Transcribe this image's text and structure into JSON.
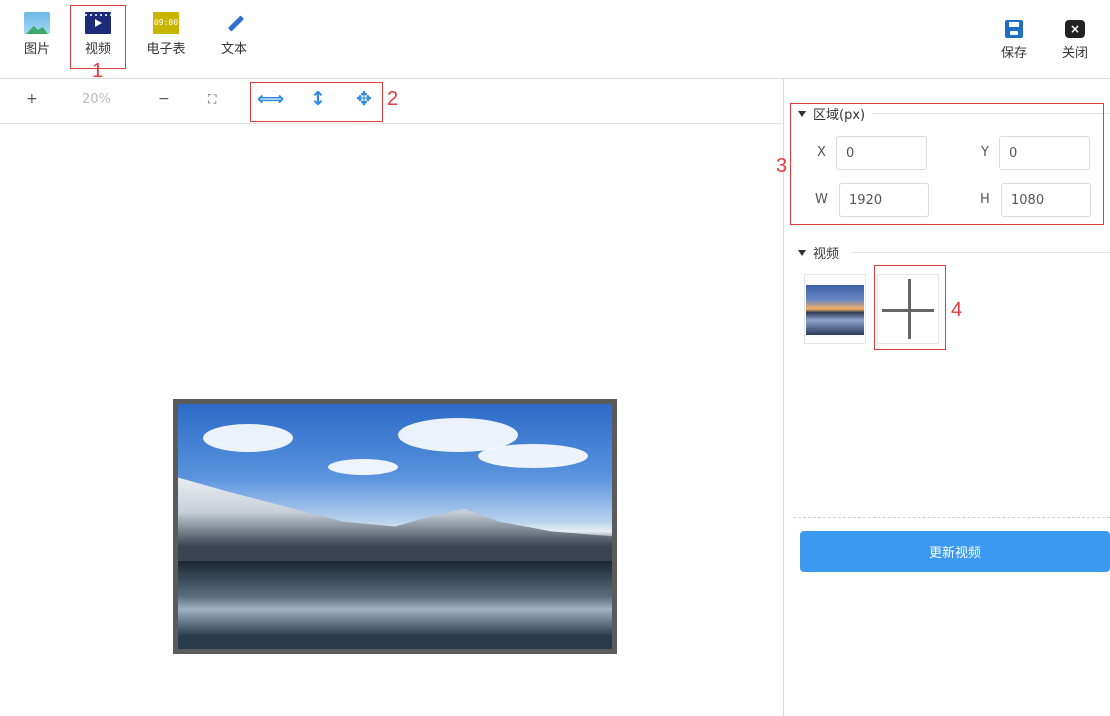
{
  "toolbar": {
    "items": [
      {
        "label": "图片",
        "icon": "image-icon"
      },
      {
        "label": "视频",
        "icon": "video-icon"
      },
      {
        "label": "电子表",
        "icon": "clock-sheet-icon",
        "icon_text": "09:00"
      },
      {
        "label": "文本",
        "icon": "pen-icon"
      }
    ],
    "save_label": "保存",
    "close_label": "关闭"
  },
  "view": {
    "zoom_in": "+",
    "zoom_level": "20%",
    "zoom_out": "−",
    "fit": "⛶",
    "stretch_horizontal": "⟺",
    "stretch_vertical": "↕",
    "move": "✥"
  },
  "region": {
    "title": "区域(px)",
    "x_label": "X",
    "x_value": "0",
    "y_label": "Y",
    "y_value": "0",
    "w_label": "W",
    "w_value": "1920",
    "h_label": "H",
    "h_value": "1080"
  },
  "video": {
    "title": "视频",
    "update_button": "更新视频"
  },
  "annotations": [
    "1",
    "2",
    "3",
    "4"
  ],
  "colors": {
    "accent": "#3b99f0",
    "annotation": "#e53b3b",
    "icon_blue": "#2e8ae6"
  }
}
